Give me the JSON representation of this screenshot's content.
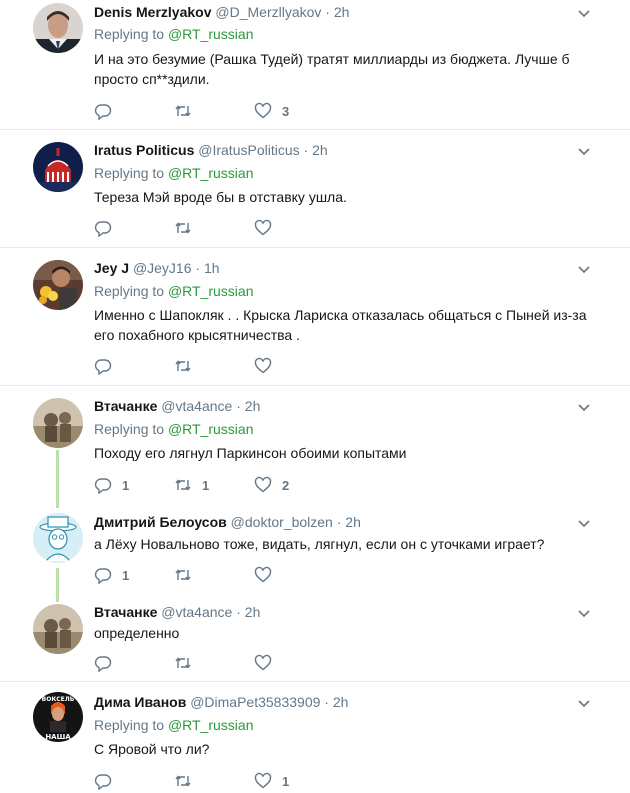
{
  "tweets": [
    {
      "name": "Denis Merzlyakov",
      "handle": "@D_Merzllyakov",
      "dot": "·",
      "time": "2h",
      "replying_label": "Replying to",
      "replying_to": "@RT_russian",
      "text": "И на это безумие (Рашка Тудей) тратят миллиарды из бюджета. Лучше б просто сп**здили.",
      "replies": "",
      "retweets": "",
      "likes": "3",
      "avatar_icon": "man-portrait-avatar"
    },
    {
      "name": "Iratus Politicus",
      "handle": "@IratusPoliticus",
      "dot": "·",
      "time": "2h",
      "replying_label": "Replying to",
      "replying_to": "@RT_russian",
      "text": "Тереза Мэй вроде бы в отставку ушла.",
      "replies": "",
      "retweets": "",
      "likes": "",
      "avatar_icon": "capitol-dome-avatar"
    },
    {
      "name": "Jey J",
      "handle": "@JeyJ16",
      "dot": "·",
      "time": "1h",
      "replying_label": "Replying to",
      "replying_to": "@RT_russian",
      "text": "Именно с Шапокляк . .   Крыска Лариска отказалась общаться с Пыней из-за его похабного крысятничества .",
      "replies": "",
      "retweets": "",
      "likes": "",
      "avatar_icon": "person-with-flowers-avatar"
    },
    {
      "name": "Втачанке",
      "handle": "@vta4ance",
      "dot": "·",
      "time": "2h",
      "replying_label": "Replying to",
      "replying_to": "@RT_russian",
      "text": "Походу его лягнул Паркинсон обоими копытами",
      "replies": "1",
      "retweets": "1",
      "likes": "2",
      "avatar_icon": "sepia-photo-avatar"
    },
    {
      "name": "Дмитрий Белоусов",
      "handle": "@doktor_bolzen",
      "dot": "·",
      "time": "2h",
      "replying_label": "",
      "replying_to": "",
      "text": "а Лёху Новальново тоже, видать, лягнул, если он с уточками играет?",
      "replies": "1",
      "retweets": "",
      "likes": "",
      "avatar_icon": "hat-man-sketch-avatar"
    },
    {
      "name": "Втачанке",
      "handle": "@vta4ance",
      "dot": "·",
      "time": "2h",
      "replying_label": "",
      "replying_to": "",
      "text": "определенно",
      "replies": "",
      "retweets": "",
      "likes": "",
      "avatar_icon": "sepia-photo-avatar"
    },
    {
      "name": "Дима Иванов",
      "handle": "@DimaPet35833909",
      "dot": "·",
      "time": "2h",
      "replying_label": "Replying to",
      "replying_to": "@RT_russian",
      "text": "С Яровой что ли?",
      "replies": "",
      "retweets": "",
      "likes": "1",
      "avatar_icon": "poster-avatar",
      "avatar_text_top": "ВОКСЕЛЬ",
      "avatar_text_bottom": "НАША"
    }
  ],
  "colors": {
    "name": "#14171a",
    "muted": "#657786",
    "link": "#2b9a3d",
    "separator": "#e6ecf0",
    "thread_line": "#b8e0a8"
  }
}
